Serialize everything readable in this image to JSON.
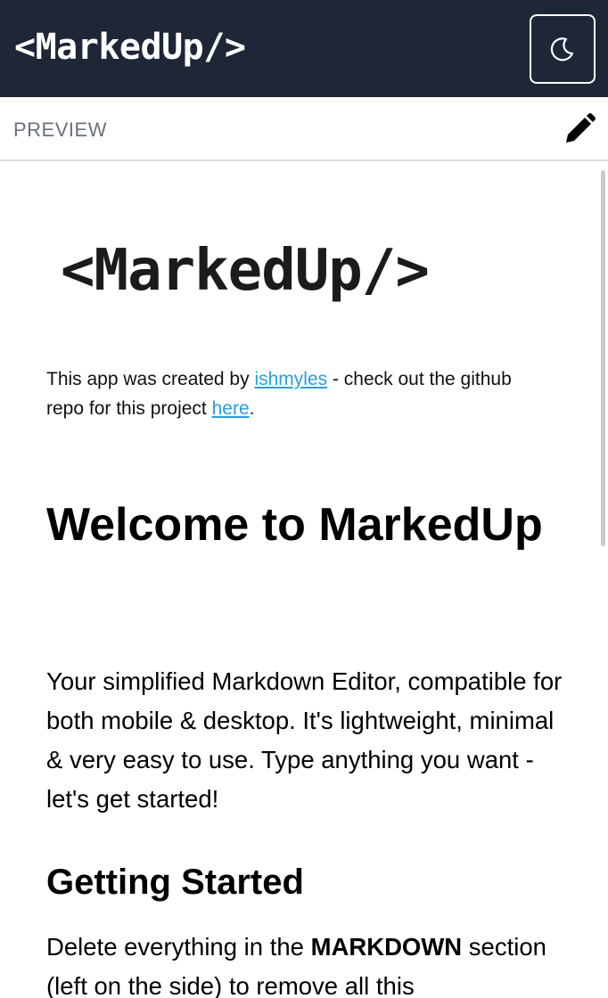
{
  "header": {
    "logo_text": "<MarkedUp/>",
    "theme_toggle_icon": "moon-icon"
  },
  "toolbar": {
    "section_label": "PREVIEW",
    "edit_icon": "pencil-icon"
  },
  "preview": {
    "logo_text": "<MarkedUp/>",
    "intro_prefix": "This app was created by ",
    "author_link": "ishmyles",
    "intro_middle": " - check out the github repo for this project ",
    "repo_link": "here",
    "intro_suffix": ".",
    "heading1": "Welcome to MarkedUp",
    "paragraph1": "Your simplified Markdown Editor, compatible for both mobile & desktop. It's lightweight, minimal & very easy to use. Type anything you want - let's get started!",
    "heading2": "Getting Started",
    "paragraph2_prefix": "Delete everything in the ",
    "paragraph2_bold": "MARKDOWN",
    "paragraph2_suffix": " section (left on the side) to remove all this"
  },
  "colors": {
    "header_bg": "#1e2737",
    "link": "#2aa0d6",
    "label_gray": "#6b7178"
  }
}
